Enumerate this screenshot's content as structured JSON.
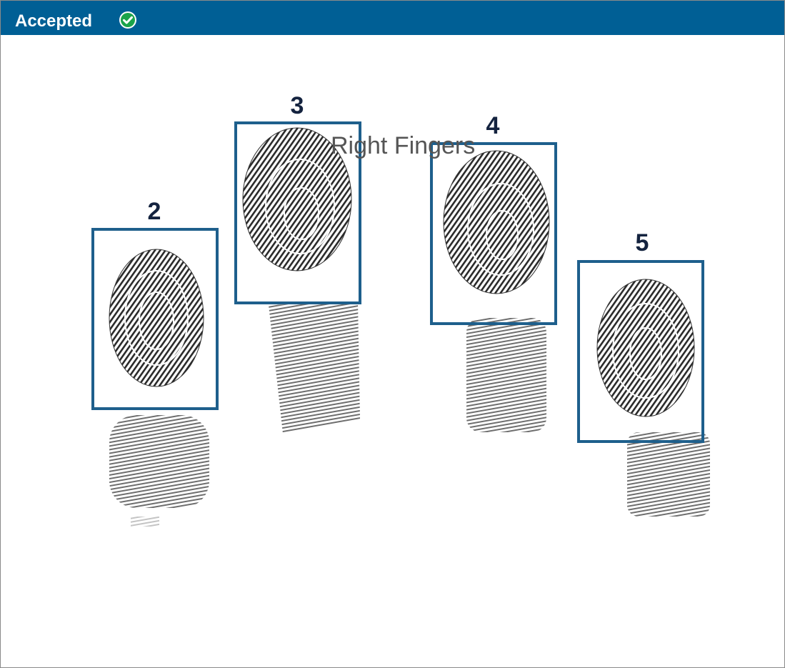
{
  "header": {
    "status_label": "Accepted",
    "status_icon": "check-circle-icon",
    "background_color": "#005f95",
    "icon_color": "#1aa34a"
  },
  "scan": {
    "caption": "Right Fingers",
    "box_color": "#1e5f8c",
    "fingers": [
      {
        "number": "2"
      },
      {
        "number": "3"
      },
      {
        "number": "4"
      },
      {
        "number": "5"
      }
    ]
  }
}
